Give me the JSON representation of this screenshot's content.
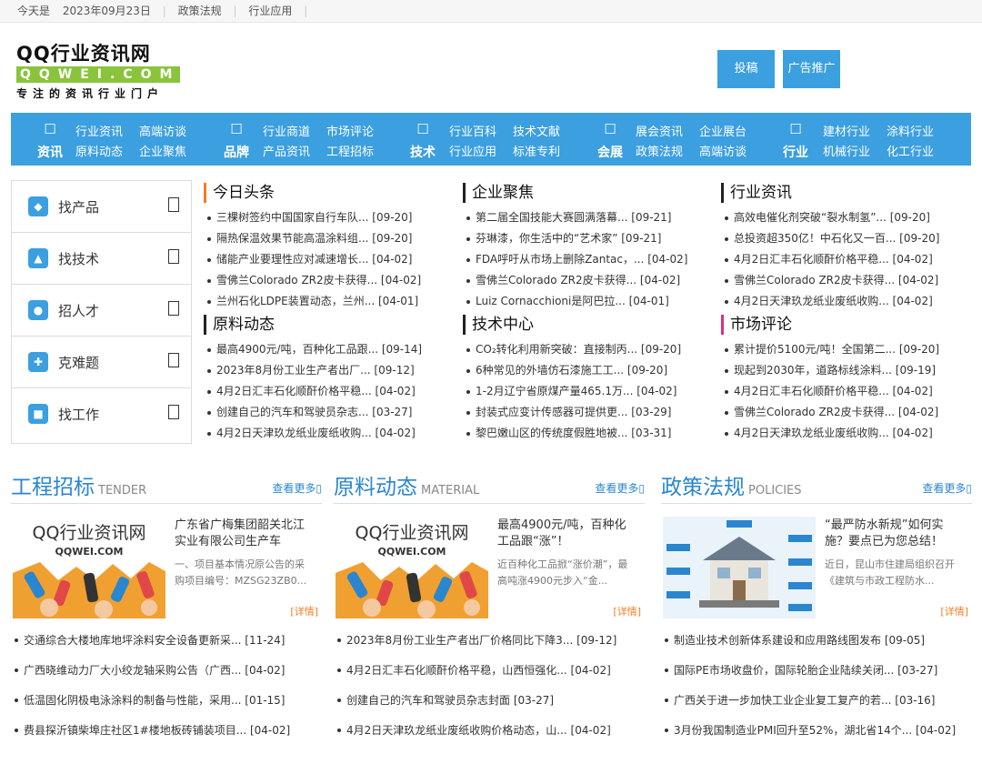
{
  "topbar": {
    "date_prefix": "今天是",
    "date": "2023年09月23日",
    "links": [
      "政策法规",
      "行业应用"
    ]
  },
  "logo": {
    "line1": "QQ行业资讯网",
    "line2": "QQWEI.COM",
    "line3": "专注的资讯行业门户"
  },
  "header_buttons": {
    "contribute": "投稿",
    "ads": "广告推广"
  },
  "nav": [
    {
      "icon": "news-icon",
      "name": "资讯",
      "links": [
        "行业资讯",
        "高端访谈",
        "原料动态",
        "企业聚焦"
      ]
    },
    {
      "icon": "brand-icon",
      "name": "品牌",
      "links": [
        "行业商道",
        "市场评论",
        "产品资讯",
        "工程招标"
      ]
    },
    {
      "icon": "tech-icon",
      "name": "技术",
      "links": [
        "行业百科",
        "技术文献",
        "行业应用",
        "标准专利"
      ]
    },
    {
      "icon": "expo-icon",
      "name": "会展",
      "links": [
        "展会资讯",
        "企业展台",
        "政策法规",
        "高端访谈"
      ]
    },
    {
      "icon": "industry-icon",
      "name": "行业",
      "links": [
        "建材行业",
        "涂料行业",
        "机械行业",
        "化工行业"
      ]
    }
  ],
  "sidebar": [
    {
      "icon": "cube-icon",
      "label": "找产品"
    },
    {
      "icon": "flask-icon",
      "label": "找技术"
    },
    {
      "icon": "graduate-icon",
      "label": "招人才"
    },
    {
      "icon": "puzzle-icon",
      "label": "克难题"
    },
    {
      "icon": "briefcase-icon",
      "label": "找工作"
    }
  ],
  "news_blocks": [
    {
      "title": "今日头条",
      "accent": "#f57d23",
      "items": [
        "三棵树签约中国国家自行车队... [09-20]",
        "隔热保温效果节能高温涂料组... [09-20]",
        "储能产业要理性应对减速增长... [04-02]",
        "雪佛兰Colorado ZR2皮卡获得... [04-02]",
        "兰州石化LDPE装置动态，兰州... [04-01]"
      ]
    },
    {
      "title": "企业聚焦",
      "accent": "#222222",
      "items": [
        "第二届全国技能大赛圆满落幕... [09-21]",
        "芬琳漆，你生活中的“艺术家” [09-21]",
        "FDA呼吁从市场上删除Zantac，... [04-02]",
        "雪佛兰Colorado ZR2皮卡获得... [04-02]",
        "Luiz Cornacchioni是阿巴拉... [04-01]"
      ]
    },
    {
      "title": "行业资讯",
      "accent": "#222222",
      "items": [
        "高效电催化剂突破“裂水制氢”... [09-20]",
        "总投资超350亿！中石化又一百... [09-20]",
        "4月2日汇丰石化顺酐价格平稳... [04-02]",
        "雪佛兰Colorado ZR2皮卡获得... [04-02]",
        "4月2日天津玖龙纸业废纸收购... [04-02]"
      ]
    },
    {
      "title": "原料动态",
      "accent": "#222222",
      "items": [
        "最高4900元/吨，百种化工品跟... [09-14]",
        "2023年8月份工业生产者出厂... [09-12]",
        "4月2日汇丰石化顺酐价格平稳... [04-02]",
        "创建自己的汽车和驾驶员杂志... [03-27]",
        "4月2日天津玖龙纸业废纸收购... [04-02]"
      ]
    },
    {
      "title": "技术中心",
      "accent": "#222222",
      "items": [
        "CO₂转化利用新突破：直接制丙... [09-20]",
        "6种常见的外墙仿石漆施工工... [09-20]",
        "1-2月辽宁省原煤产量465.1万... [04-02]",
        "封装式应变计传感器可提供更... [03-29]",
        "黎巴嫩山区的传统度假胜地被... [03-31]"
      ]
    },
    {
      "title": "市场评论",
      "accent": "#d9327a",
      "items": [
        "累计提价5100元/吨！全国第二... [09-20]",
        "现起到2030年，道路标线涂料... [09-19]",
        "4月2日汇丰石化顺酐价格平稳... [04-02]",
        "雪佛兰Colorado ZR2皮卡获得... [04-02]",
        "4月2日天津玖龙纸业废纸收购... [04-02]"
      ]
    }
  ],
  "sections": [
    {
      "cn": "工程招标",
      "en": "TENDER",
      "more": "查看更多",
      "img_type": "logo",
      "img_line1": "QQ行业资讯网",
      "img_line2": "QQWEI.COM",
      "feat_title": "广东省广梅集团韶关北江实业有限公司生产车",
      "feat_desc": "一、项目基本情况原公告的采购项目编号：MZSG23ZB0...",
      "detail": "[详情]",
      "items": [
        "交通综合大楼地库地坪涂料安全设备更新采... [11-24]",
        "广西晓维动力厂大小绞龙轴采购公告（广西... [04-02]",
        "低温固化阴极电泳涂料的制备与性能，采用... [01-15]",
        "费县探沂镇柴埠庄社区1#楼地板砖铺装项目... [04-02]"
      ]
    },
    {
      "cn": "原料动态",
      "en": "MATERIAL",
      "more": "查看更多",
      "img_type": "logo",
      "img_line1": "QQ行业资讯网",
      "img_line2": "QQWEI.COM",
      "feat_title": "最高4900元/吨，百种化工品跟“涨”！",
      "feat_desc": "近百种化工品掀“涨价潮”，最高吨涨4900元步入“金...",
      "detail": "[详情]",
      "items": [
        "2023年8月份工业生产者出厂价格同比下降3... [09-12]",
        "4月2日汇丰石化顺酐价格平稳，山西恒强化... [04-02]",
        "创建自己的汽车和驾驶员杂志封面 [03-27]",
        "4月2日天津玖龙纸业废纸收购价格动态，山... [04-02]"
      ]
    },
    {
      "cn": "政策法规",
      "en": "POLICIES",
      "more": "查看更多",
      "img_type": "house",
      "img_line1": "",
      "img_line2": "",
      "feat_title": "“最严防水新规”如何实施？要点已为您总结！",
      "feat_desc": "近日，昆山市住建局组织召开《建筑与市政工程防水...",
      "detail": "[详情]",
      "items": [
        "制造业技术创新体系建设和应用路线图发布 [09-05]",
        "国际PE市场收盘价，国际轮胎企业陆续关闭... [03-27]",
        "广西关于进一步加快工业企业复工复产的若... [03-16]",
        "3月份我国制造业PMI回升至52%，湖北省14个... [04-02]"
      ]
    }
  ]
}
